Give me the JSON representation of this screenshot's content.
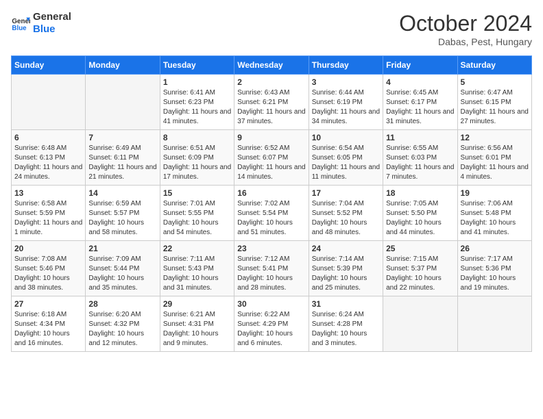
{
  "header": {
    "logo_line1": "General",
    "logo_line2": "Blue",
    "month": "October 2024",
    "location": "Dabas, Pest, Hungary"
  },
  "days_of_week": [
    "Sunday",
    "Monday",
    "Tuesday",
    "Wednesday",
    "Thursday",
    "Friday",
    "Saturday"
  ],
  "weeks": [
    [
      {
        "day": "",
        "info": ""
      },
      {
        "day": "",
        "info": ""
      },
      {
        "day": "1",
        "sunrise": "6:41 AM",
        "sunset": "6:23 PM",
        "daylight": "11 hours and 41 minutes."
      },
      {
        "day": "2",
        "sunrise": "6:43 AM",
        "sunset": "6:21 PM",
        "daylight": "11 hours and 37 minutes."
      },
      {
        "day": "3",
        "sunrise": "6:44 AM",
        "sunset": "6:19 PM",
        "daylight": "11 hours and 34 minutes."
      },
      {
        "day": "4",
        "sunrise": "6:45 AM",
        "sunset": "6:17 PM",
        "daylight": "11 hours and 31 minutes."
      },
      {
        "day": "5",
        "sunrise": "6:47 AM",
        "sunset": "6:15 PM",
        "daylight": "11 hours and 27 minutes."
      }
    ],
    [
      {
        "day": "6",
        "sunrise": "6:48 AM",
        "sunset": "6:13 PM",
        "daylight": "11 hours and 24 minutes."
      },
      {
        "day": "7",
        "sunrise": "6:49 AM",
        "sunset": "6:11 PM",
        "daylight": "11 hours and 21 minutes."
      },
      {
        "day": "8",
        "sunrise": "6:51 AM",
        "sunset": "6:09 PM",
        "daylight": "11 hours and 17 minutes."
      },
      {
        "day": "9",
        "sunrise": "6:52 AM",
        "sunset": "6:07 PM",
        "daylight": "11 hours and 14 minutes."
      },
      {
        "day": "10",
        "sunrise": "6:54 AM",
        "sunset": "6:05 PM",
        "daylight": "11 hours and 11 minutes."
      },
      {
        "day": "11",
        "sunrise": "6:55 AM",
        "sunset": "6:03 PM",
        "daylight": "11 hours and 7 minutes."
      },
      {
        "day": "12",
        "sunrise": "6:56 AM",
        "sunset": "6:01 PM",
        "daylight": "11 hours and 4 minutes."
      }
    ],
    [
      {
        "day": "13",
        "sunrise": "6:58 AM",
        "sunset": "5:59 PM",
        "daylight": "11 hours and 1 minute."
      },
      {
        "day": "14",
        "sunrise": "6:59 AM",
        "sunset": "5:57 PM",
        "daylight": "10 hours and 58 minutes."
      },
      {
        "day": "15",
        "sunrise": "7:01 AM",
        "sunset": "5:55 PM",
        "daylight": "10 hours and 54 minutes."
      },
      {
        "day": "16",
        "sunrise": "7:02 AM",
        "sunset": "5:54 PM",
        "daylight": "10 hours and 51 minutes."
      },
      {
        "day": "17",
        "sunrise": "7:04 AM",
        "sunset": "5:52 PM",
        "daylight": "10 hours and 48 minutes."
      },
      {
        "day": "18",
        "sunrise": "7:05 AM",
        "sunset": "5:50 PM",
        "daylight": "10 hours and 44 minutes."
      },
      {
        "day": "19",
        "sunrise": "7:06 AM",
        "sunset": "5:48 PM",
        "daylight": "10 hours and 41 minutes."
      }
    ],
    [
      {
        "day": "20",
        "sunrise": "7:08 AM",
        "sunset": "5:46 PM",
        "daylight": "10 hours and 38 minutes."
      },
      {
        "day": "21",
        "sunrise": "7:09 AM",
        "sunset": "5:44 PM",
        "daylight": "10 hours and 35 minutes."
      },
      {
        "day": "22",
        "sunrise": "7:11 AM",
        "sunset": "5:43 PM",
        "daylight": "10 hours and 31 minutes."
      },
      {
        "day": "23",
        "sunrise": "7:12 AM",
        "sunset": "5:41 PM",
        "daylight": "10 hours and 28 minutes."
      },
      {
        "day": "24",
        "sunrise": "7:14 AM",
        "sunset": "5:39 PM",
        "daylight": "10 hours and 25 minutes."
      },
      {
        "day": "25",
        "sunrise": "7:15 AM",
        "sunset": "5:37 PM",
        "daylight": "10 hours and 22 minutes."
      },
      {
        "day": "26",
        "sunrise": "7:17 AM",
        "sunset": "5:36 PM",
        "daylight": "10 hours and 19 minutes."
      }
    ],
    [
      {
        "day": "27",
        "sunrise": "6:18 AM",
        "sunset": "4:34 PM",
        "daylight": "10 hours and 16 minutes."
      },
      {
        "day": "28",
        "sunrise": "6:20 AM",
        "sunset": "4:32 PM",
        "daylight": "10 hours and 12 minutes."
      },
      {
        "day": "29",
        "sunrise": "6:21 AM",
        "sunset": "4:31 PM",
        "daylight": "10 hours and 9 minutes."
      },
      {
        "day": "30",
        "sunrise": "6:22 AM",
        "sunset": "4:29 PM",
        "daylight": "10 hours and 6 minutes."
      },
      {
        "day": "31",
        "sunrise": "6:24 AM",
        "sunset": "4:28 PM",
        "daylight": "10 hours and 3 minutes."
      },
      {
        "day": "",
        "info": ""
      },
      {
        "day": "",
        "info": ""
      }
    ]
  ],
  "labels": {
    "sunrise": "Sunrise:",
    "sunset": "Sunset:",
    "daylight": "Daylight:"
  }
}
